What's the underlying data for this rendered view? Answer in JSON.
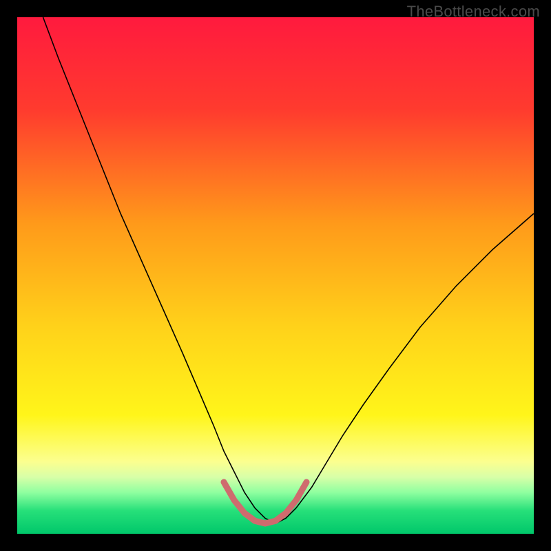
{
  "watermark": "TheBottleneck.com",
  "chart_data": {
    "type": "line",
    "title": "",
    "xlabel": "",
    "ylabel": "",
    "xlim": [
      0,
      100
    ],
    "ylim": [
      0,
      100
    ],
    "grid": false,
    "legend": false,
    "background_gradient": {
      "stops": [
        {
          "offset": 0.0,
          "color": "#ff1a3e"
        },
        {
          "offset": 0.18,
          "color": "#ff3b2e"
        },
        {
          "offset": 0.4,
          "color": "#ff9a1a"
        },
        {
          "offset": 0.6,
          "color": "#ffd21a"
        },
        {
          "offset": 0.77,
          "color": "#fff51a"
        },
        {
          "offset": 0.86,
          "color": "#fcff8f"
        },
        {
          "offset": 0.89,
          "color": "#d8ffa8"
        },
        {
          "offset": 0.92,
          "color": "#8fffa0"
        },
        {
          "offset": 0.955,
          "color": "#27e07a"
        },
        {
          "offset": 1.0,
          "color": "#00c76a"
        }
      ]
    },
    "series": [
      {
        "name": "bottleneck-curve",
        "color": "#000000",
        "width": 1.6,
        "x": [
          5,
          8,
          12,
          16,
          20,
          24,
          28,
          32,
          35,
          38,
          40,
          42,
          44,
          46,
          48,
          50,
          52,
          54,
          57,
          60,
          63,
          67,
          72,
          78,
          85,
          92,
          100
        ],
        "y": [
          100,
          92,
          82,
          72,
          62,
          53,
          44,
          35,
          28,
          21,
          16,
          12,
          8,
          5,
          3,
          2,
          3,
          5,
          9,
          14,
          19,
          25,
          32,
          40,
          48,
          55,
          62
        ]
      },
      {
        "name": "tolerance-band",
        "color": "#cf6b6e",
        "width": 9,
        "linecap": "round",
        "x": [
          40,
          42,
          44,
          46,
          48,
          50,
          52,
          54,
          56
        ],
        "y": [
          10,
          6.5,
          4,
          2.5,
          2,
          2.5,
          4,
          6.5,
          10
        ]
      }
    ]
  }
}
